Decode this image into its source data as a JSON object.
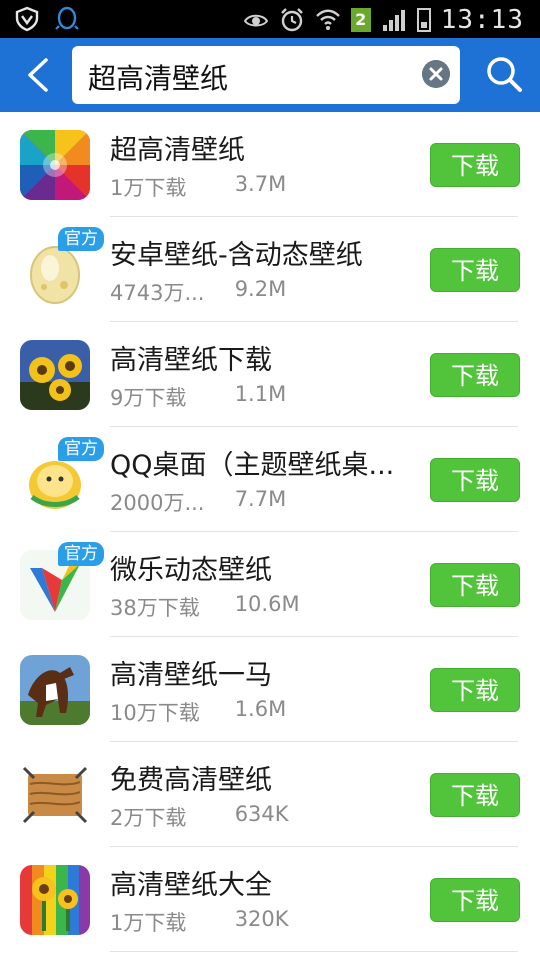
{
  "status_bar": {
    "time": "13:13",
    "sim_badge": "2",
    "icons": [
      "vpn-shield-icon",
      "qq-penguin-icon",
      "eye-icon",
      "alarm-icon",
      "wifi-icon",
      "signal-icon",
      "battery-icon"
    ]
  },
  "header": {
    "search_query": "超高清壁纸",
    "accent_color": "#1f72d5"
  },
  "apps": [
    {
      "name": "超高清壁纸",
      "downloads": "1万下载",
      "size": "3.7M",
      "official": "",
      "button": "下载",
      "icon": "colorful-swirl-icon"
    },
    {
      "name": "安卓壁纸-含动态壁纸",
      "downloads": "4743万...",
      "size": "9.2M",
      "official": "官方",
      "button": "下载",
      "icon": "egg-icon"
    },
    {
      "name": "高清壁纸下载",
      "downloads": "9万下载",
      "size": "1.1M",
      "official": "",
      "button": "下载",
      "icon": "sunflower-photo-icon"
    },
    {
      "name": "QQ桌面（主题壁纸桌...",
      "downloads": "2000万...",
      "size": "7.7M",
      "official": "官方",
      "button": "下载",
      "icon": "qq-chick-icon"
    },
    {
      "name": "微乐动态壁纸",
      "downloads": "38万下载",
      "size": "10.6M",
      "official": "官方",
      "button": "下载",
      "icon": "v-logo-icon"
    },
    {
      "name": "高清壁纸一马",
      "downloads": "10万下载",
      "size": "1.6M",
      "official": "",
      "button": "下载",
      "icon": "horse-photo-icon"
    },
    {
      "name": "免费高清壁纸",
      "downloads": "2万下载",
      "size": "634K",
      "official": "",
      "button": "下载",
      "icon": "wood-frame-icon"
    },
    {
      "name": "高清壁纸大全",
      "downloads": "1万下载",
      "size": "320K",
      "official": "",
      "button": "下载",
      "icon": "sunflower-rainbow-icon"
    }
  ],
  "colors": {
    "download_button": "#52c43c",
    "official_badge": "#2b9ee8"
  }
}
